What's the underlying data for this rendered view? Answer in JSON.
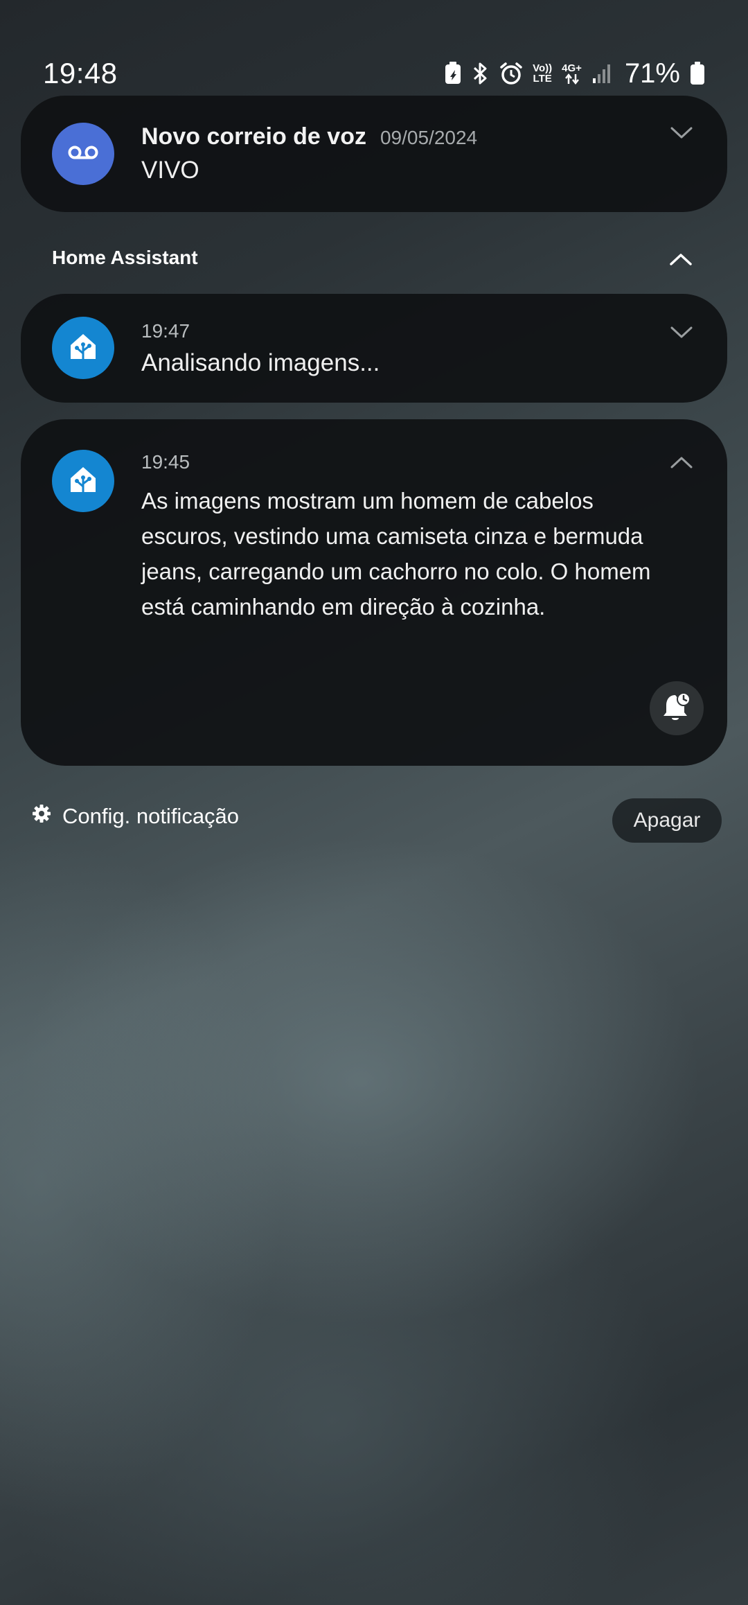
{
  "status_bar": {
    "time": "19:48",
    "volte_label": [
      "Vo))",
      "LTE"
    ],
    "network_label": [
      "4G+"
    ],
    "battery_percent": "71%",
    "icons": [
      "battery-saver-icon",
      "bluetooth-icon",
      "alarm-icon",
      "volte-icon",
      "network-4g-icon",
      "signal-icon",
      "battery-icon"
    ]
  },
  "voicemail_notification": {
    "title": "Novo correio de voz",
    "date": "09/05/2024",
    "subtitle": "VIVO",
    "icon": "voicemail-icon",
    "icon_color": "#4a6fd6"
  },
  "group": {
    "name": "Home Assistant",
    "icon_color": "#1486d1",
    "notifications": [
      {
        "time": "19:47",
        "text": "Analisando imagens..."
      },
      {
        "time": "19:45",
        "text": "As imagens mostram um homem de cabelos escuros, vestindo uma camiseta cinza e bermuda jeans, carregando um cachorro no colo. O homem está caminhando em direção à cozinha."
      }
    ]
  },
  "footer": {
    "settings_label": "Config. notificação",
    "clear_label": "Apagar"
  }
}
